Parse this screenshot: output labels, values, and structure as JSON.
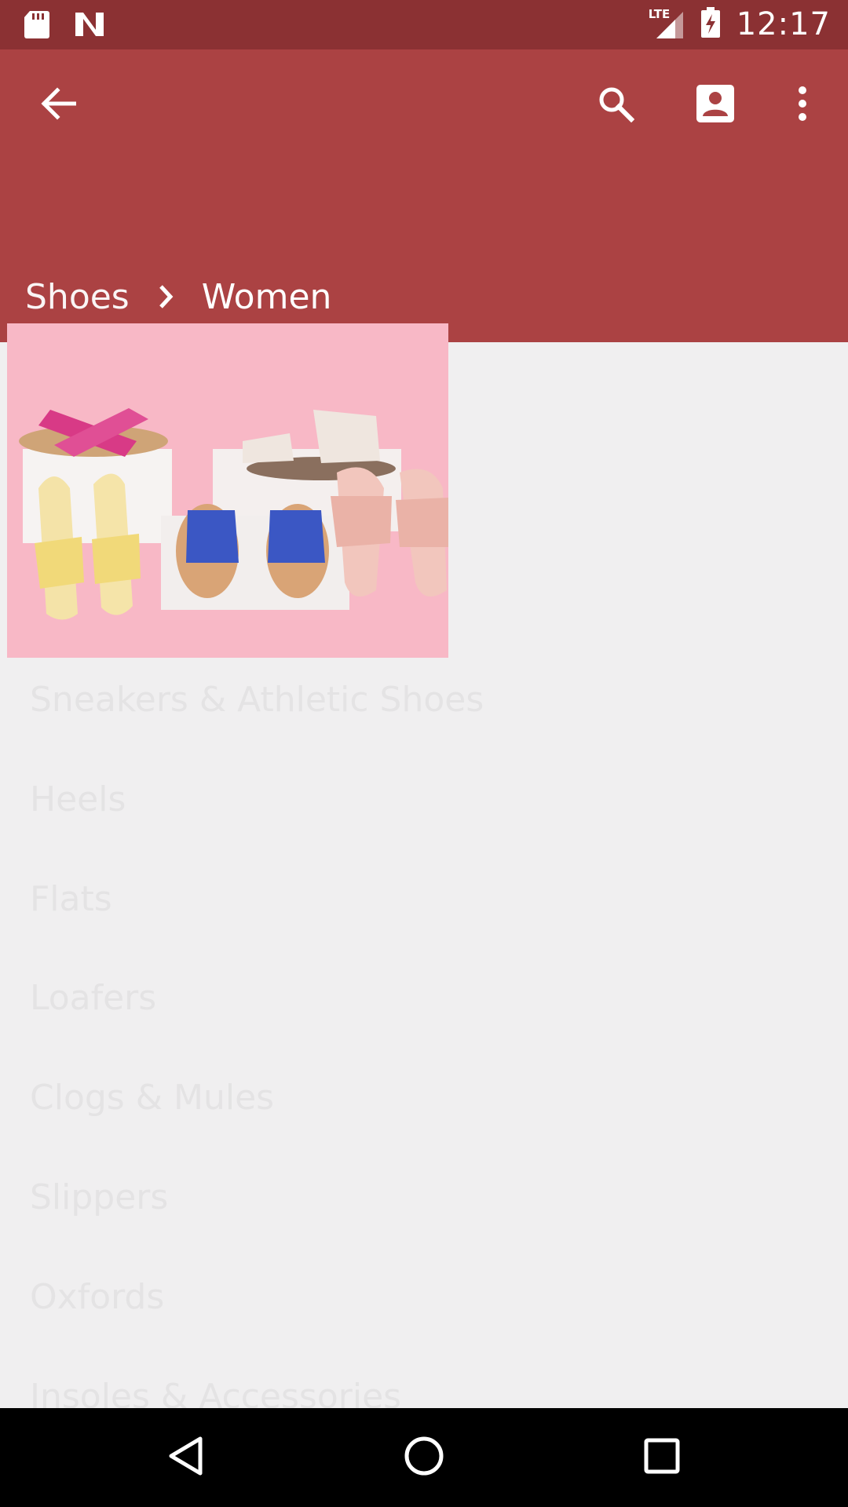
{
  "status_bar": {
    "time": "12:17",
    "network_label": "LTE",
    "icons": [
      "sd-card-icon",
      "n-notification-icon",
      "lte-signal-icon",
      "battery-charging-icon"
    ]
  },
  "app_bar": {
    "background": "#ab4243",
    "breadcrumb": {
      "parent": "Shoes",
      "current": "Women"
    },
    "icons": [
      "back-arrow-icon",
      "search-icon",
      "account-box-icon",
      "more-vert-icon"
    ]
  },
  "image": {
    "description_icon": "shoes-photo",
    "background": "#f7b6c4"
  },
  "categories": [
    "Sneakers & Athletic Shoes",
    "Heels",
    "Flats",
    "Loafers",
    "Clogs & Mules",
    "Slippers",
    "Oxfords",
    "Insoles & Accessories"
  ],
  "nav_bar": {
    "icons": [
      "back-triangle-icon",
      "home-circle-icon",
      "recents-square-icon"
    ]
  }
}
